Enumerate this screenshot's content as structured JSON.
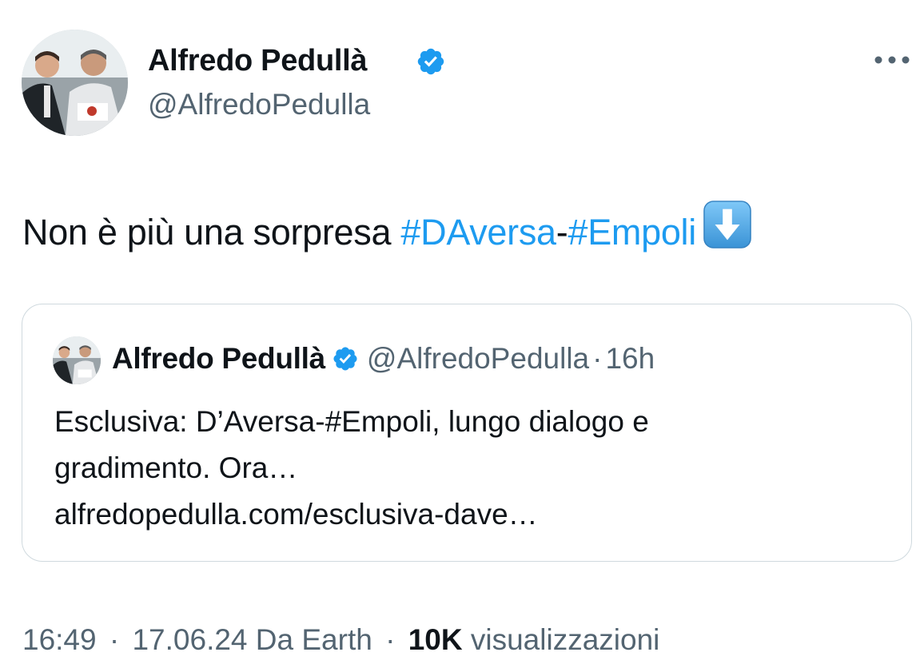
{
  "author": {
    "name": "Alfredo Pedullà",
    "handle": "@AlfredoPedulla",
    "verified": true
  },
  "tweet": {
    "text_prefix": "Non è più una sorpresa ",
    "hashtag_1": "#DAversa",
    "dash": "-",
    "hashtag_2": "#Empoli",
    "emoji": "down-arrow-emoji"
  },
  "quoted": {
    "name": "Alfredo Pedullà",
    "handle": "@AlfredoPedulla",
    "separator": "·",
    "time": "16h",
    "lines": [
      "Esclusiva: D’Aversa-#Empoli, lungo dialogo e",
      "gradimento. Ora…",
      "alfredopedulla.com/esclusiva-dave…"
    ]
  },
  "meta": {
    "time": "16:49",
    "sep1": "·",
    "date": "17.06.24",
    "source": "Da Earth",
    "sep2": "·",
    "views_count": "10K",
    "views_label": "visualizzazioni"
  },
  "colors": {
    "accent": "#1d9bf0",
    "text": "#0f1419",
    "secondary": "#536471",
    "border": "#cfd9de"
  }
}
